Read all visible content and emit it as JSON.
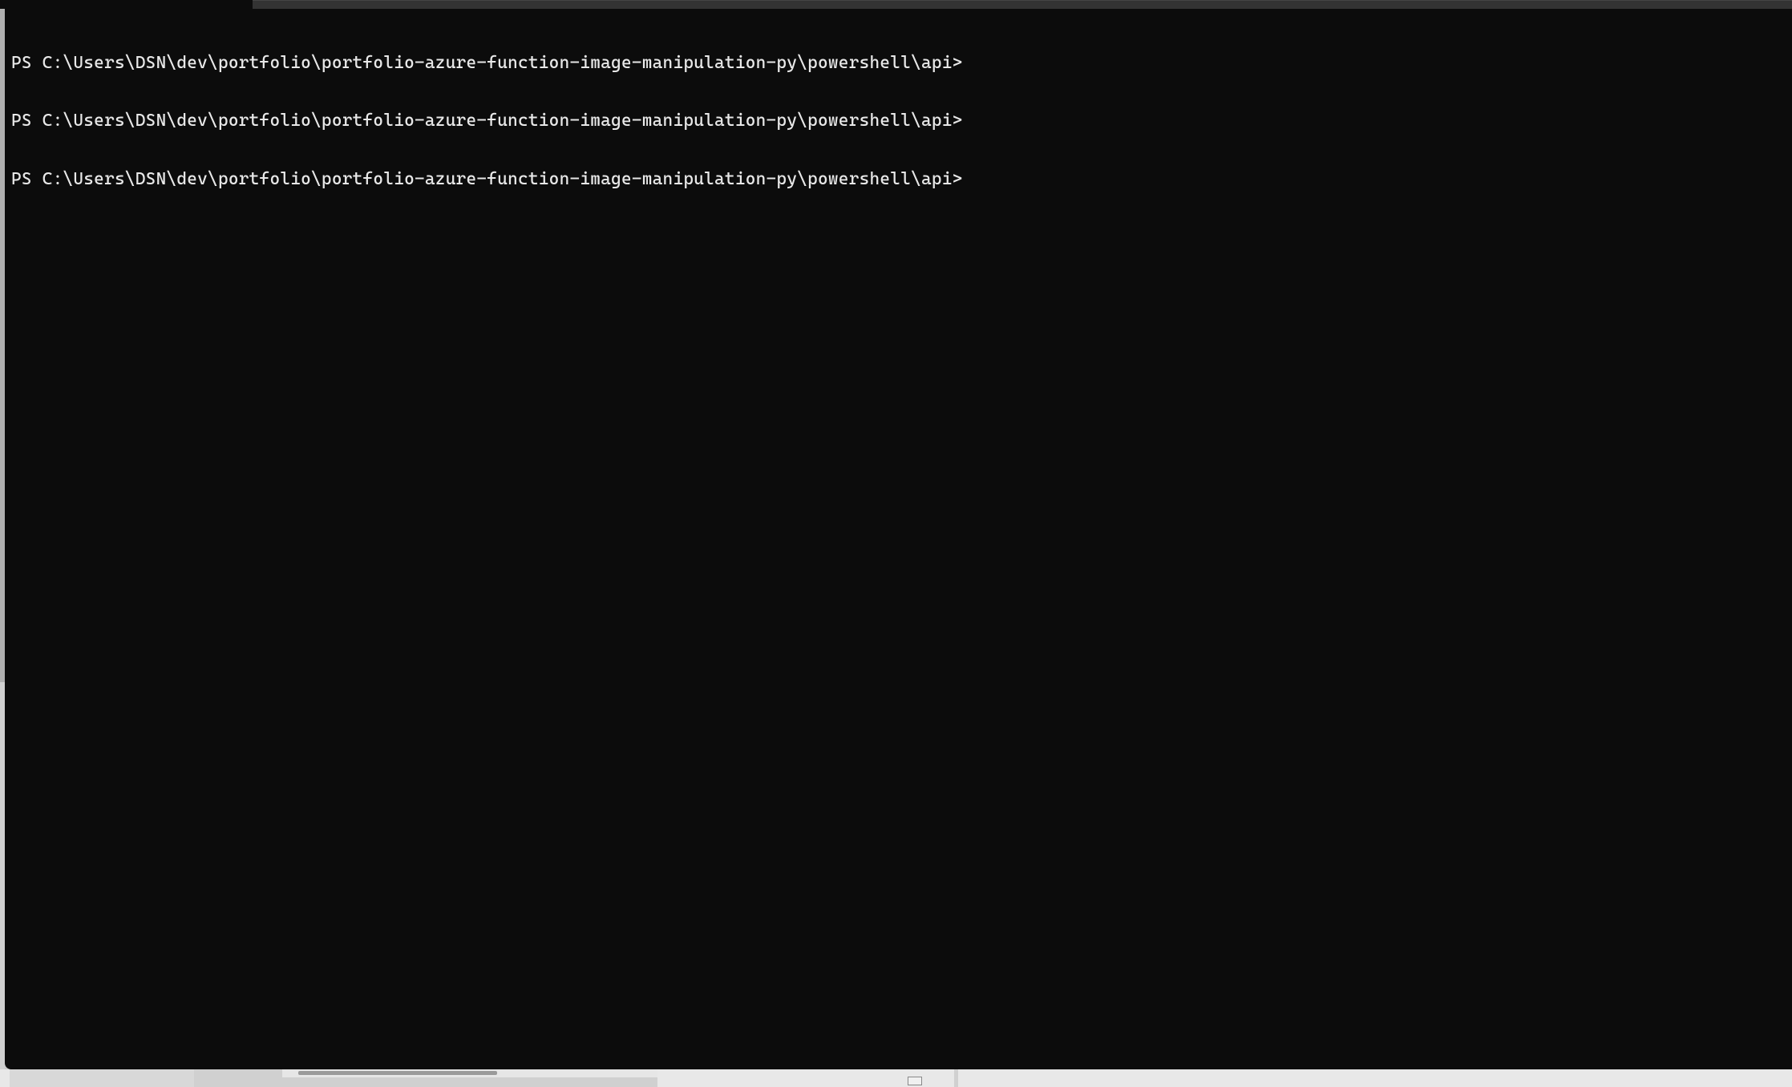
{
  "terminal": {
    "prompts": [
      "PS C:\\Users\\DSN\\dev\\portfolio\\portfolio-azure-function-image-manipulation-py\\powershell\\api>",
      "PS C:\\Users\\DSN\\dev\\portfolio\\portfolio-azure-function-image-manipulation-py\\powershell\\api>",
      "PS C:\\Users\\DSN\\dev\\portfolio\\portfolio-azure-function-image-manipulation-py\\powershell\\api>"
    ],
    "current_input": ""
  }
}
